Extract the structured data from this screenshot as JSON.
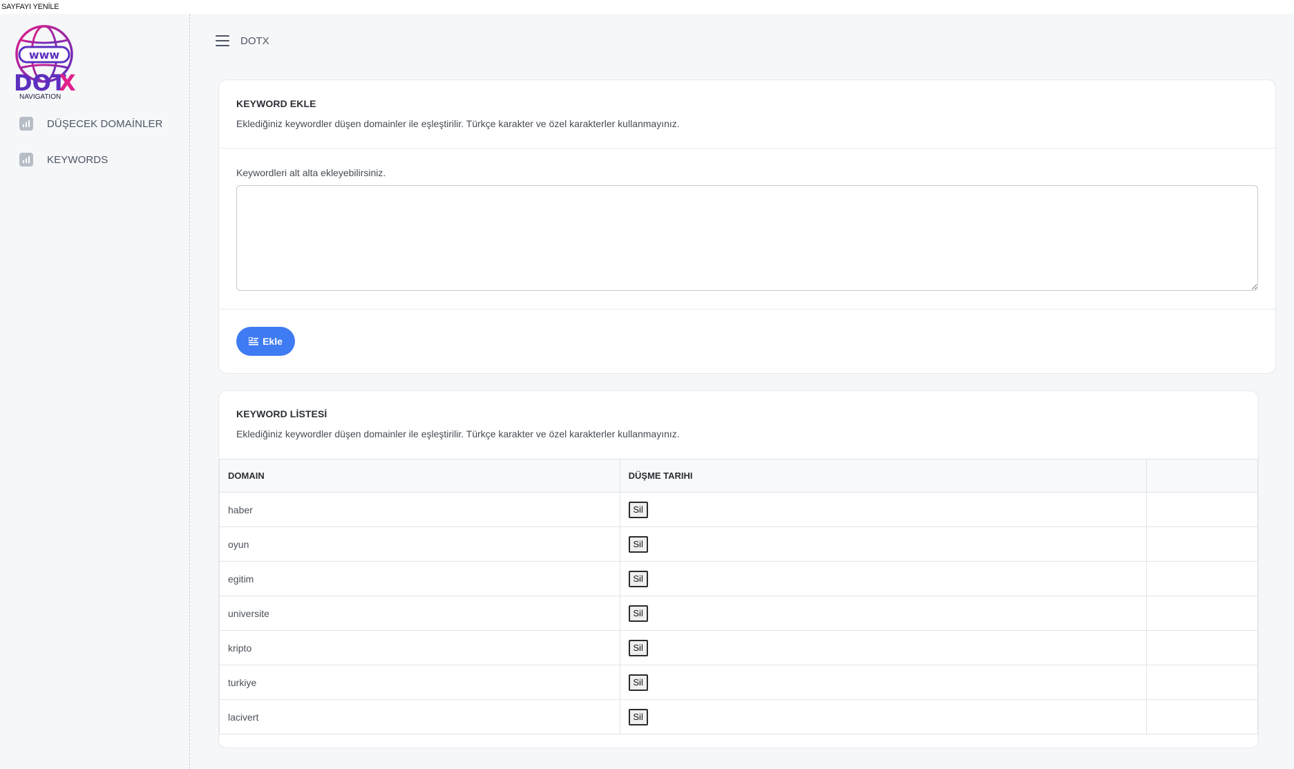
{
  "topbar": {
    "label": "SAYFAYI YENİLE"
  },
  "brand": {
    "name_main": "DOT",
    "name_accent": "X",
    "subtitle": "NAVIGATION",
    "globe_text": "www",
    "accent_color": "#e0208a",
    "primary_color": "#6a2bb5"
  },
  "sidebar": {
    "items": [
      {
        "label": "DÜŞECEK DOMAİNLER",
        "icon": "chart-icon"
      },
      {
        "label": "KEYWORDS",
        "icon": "chart-icon"
      }
    ]
  },
  "header": {
    "title": "DOTX"
  },
  "add_card": {
    "title": "KEYWORD EKLE",
    "subtitle": "Eklediğiniz keywordler düşen domainler ile eşleştirilir. Türkçe karakter ve özel karakterler kullanmayınız.",
    "field_label": "Keywordleri alt alta ekleyebilirsiniz.",
    "textarea_value": "",
    "button_label": "Ekle",
    "button_color": "#3f7bf2"
  },
  "list_card": {
    "title": "KEYWORD LİSTESİ",
    "subtitle": "Eklediğiniz keywordler düşen domainler ile eşleştirilir. Türkçe karakter ve özel karakterler kullanmayınız.",
    "columns": [
      "DOMAIN",
      "DÜŞME TARIHI",
      ""
    ],
    "rows": [
      {
        "domain": "haber",
        "action": "Sil"
      },
      {
        "domain": "oyun",
        "action": "Sil"
      },
      {
        "domain": "egitim",
        "action": "Sil"
      },
      {
        "domain": "universite",
        "action": "Sil"
      },
      {
        "domain": "kripto",
        "action": "Sil"
      },
      {
        "domain": "turkiye",
        "action": "Sil"
      },
      {
        "domain": "lacivert",
        "action": "Sil"
      }
    ]
  }
}
